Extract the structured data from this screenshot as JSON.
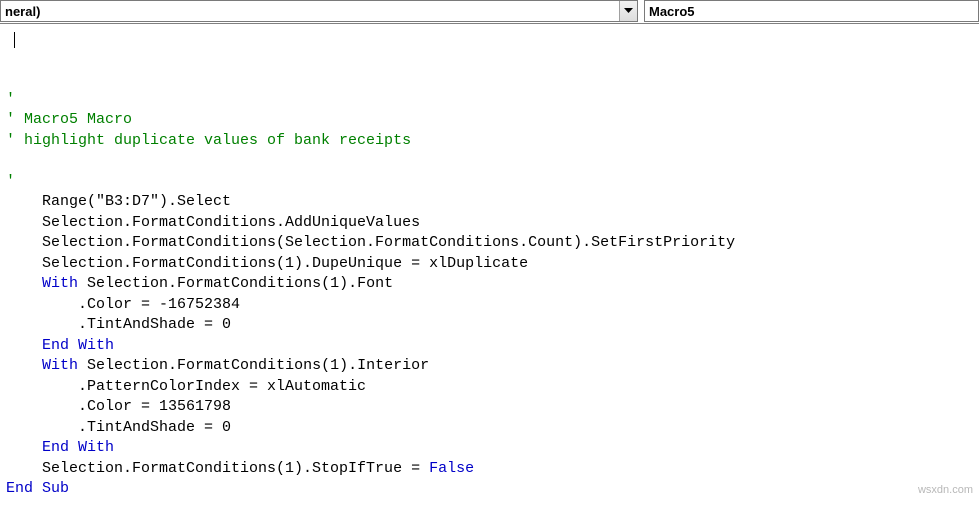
{
  "toolbar": {
    "object_selector": "neral)",
    "procedure_selector": "Macro5"
  },
  "code": {
    "lines": [
      {
        "indent": 0,
        "segments": [
          {
            "cls": "c-comment",
            "text": "'"
          }
        ]
      },
      {
        "indent": 0,
        "segments": [
          {
            "cls": "c-comment",
            "text": "' Macro5 Macro"
          }
        ]
      },
      {
        "indent": 0,
        "segments": [
          {
            "cls": "c-comment",
            "text": "' highlight duplicate values of bank receipts"
          }
        ]
      },
      {
        "indent": 0,
        "segments": []
      },
      {
        "indent": 0,
        "segments": [
          {
            "cls": "c-comment",
            "text": "'"
          }
        ]
      },
      {
        "indent": 4,
        "segments": [
          {
            "cls": "",
            "text": "Range(\"B3:D7\").Select"
          }
        ]
      },
      {
        "indent": 4,
        "segments": [
          {
            "cls": "",
            "text": "Selection.FormatConditions.AddUniqueValues"
          }
        ]
      },
      {
        "indent": 4,
        "segments": [
          {
            "cls": "",
            "text": "Selection.FormatConditions(Selection.FormatConditions.Count).SetFirstPriority"
          }
        ]
      },
      {
        "indent": 4,
        "segments": [
          {
            "cls": "",
            "text": "Selection.FormatConditions(1).DupeUnique = xlDuplicate"
          }
        ]
      },
      {
        "indent": 4,
        "segments": [
          {
            "cls": "c-kw",
            "text": "With"
          },
          {
            "cls": "",
            "text": " Selection.FormatConditions(1).Font"
          }
        ]
      },
      {
        "indent": 8,
        "segments": [
          {
            "cls": "",
            "text": ".Color = -16752384"
          }
        ]
      },
      {
        "indent": 8,
        "segments": [
          {
            "cls": "",
            "text": ".TintAndShade = 0"
          }
        ]
      },
      {
        "indent": 4,
        "segments": [
          {
            "cls": "c-kw",
            "text": "End With"
          }
        ]
      },
      {
        "indent": 4,
        "segments": [
          {
            "cls": "c-kw",
            "text": "With"
          },
          {
            "cls": "",
            "text": " Selection.FormatConditions(1).Interior"
          }
        ]
      },
      {
        "indent": 8,
        "segments": [
          {
            "cls": "",
            "text": ".PatternColorIndex = xlAutomatic"
          }
        ]
      },
      {
        "indent": 8,
        "segments": [
          {
            "cls": "",
            "text": ".Color = 13561798"
          }
        ]
      },
      {
        "indent": 8,
        "segments": [
          {
            "cls": "",
            "text": ".TintAndShade = 0"
          }
        ]
      },
      {
        "indent": 4,
        "segments": [
          {
            "cls": "c-kw",
            "text": "End With"
          }
        ]
      },
      {
        "indent": 4,
        "segments": [
          {
            "cls": "",
            "text": "Selection.FormatConditions(1).StopIfTrue = "
          },
          {
            "cls": "c-kw",
            "text": "False"
          }
        ]
      },
      {
        "indent": 0,
        "segments": [
          {
            "cls": "c-kw",
            "text": "End Sub"
          }
        ]
      }
    ]
  },
  "watermark": "wsxdn.com"
}
